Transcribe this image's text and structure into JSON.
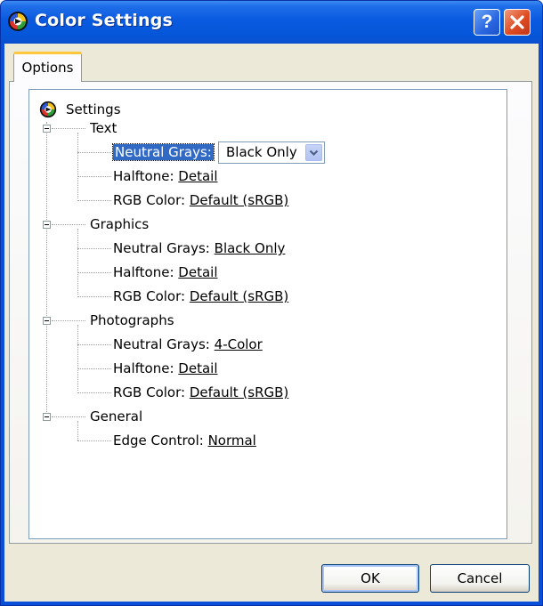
{
  "window": {
    "title": "Color Settings"
  },
  "tabs": [
    {
      "label": "Options"
    }
  ],
  "tree": {
    "root": "Settings",
    "groups": [
      {
        "label": "Text",
        "items": [
          {
            "label": "Neutral Grays:",
            "value": "Black Only"
          },
          {
            "label": "Halftone:",
            "value": "Detail"
          },
          {
            "label": "RGB Color:",
            "value": "Default (sRGB)"
          }
        ]
      },
      {
        "label": "Graphics",
        "items": [
          {
            "label": "Neutral Grays:",
            "value": "Black Only"
          },
          {
            "label": "Halftone:",
            "value": "Detail"
          },
          {
            "label": "RGB Color:",
            "value": "Default (sRGB)"
          }
        ]
      },
      {
        "label": "Photographs",
        "items": [
          {
            "label": "Neutral Grays:",
            "value": "4-Color"
          },
          {
            "label": "Halftone:",
            "value": "Detail"
          },
          {
            "label": "RGB Color:",
            "value": "Default (sRGB)"
          }
        ]
      },
      {
        "label": "General",
        "items": [
          {
            "label": "Edge Control:",
            "value": "Normal"
          }
        ]
      }
    ]
  },
  "buttons": {
    "ok": "OK",
    "cancel": "Cancel"
  },
  "icons": {
    "app": "color-settings-app-icon",
    "help": "help-icon",
    "close": "close-icon",
    "root": "settings-tree-icon",
    "dropdown": "chevron-down-icon"
  }
}
